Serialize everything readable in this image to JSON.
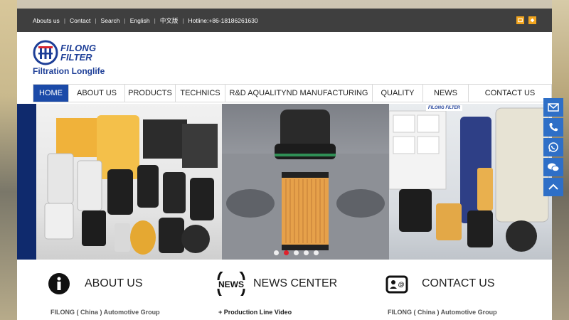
{
  "topbar": {
    "links": [
      "Abouts  us",
      "Contact",
      "Search",
      "English",
      "中文版",
      "Hotline:+86-18186261630"
    ]
  },
  "logo": {
    "name_line1": "FILONG",
    "name_line2": "FILTER",
    "tagline": "Filtration Longlife",
    "brand_color": "#1d3e97"
  },
  "nav": {
    "items": [
      {
        "label": "HOME",
        "active": true
      },
      {
        "label": "ABOUT US"
      },
      {
        "label": "PRODUCTS"
      },
      {
        "label": "TECHNICS"
      },
      {
        "label": "R&D AQUALITYND MANUFACTURING"
      },
      {
        "label": "QUALITY"
      },
      {
        "label": "NEWS"
      },
      {
        "label": "CONTACT US"
      }
    ],
    "active_color": "#1b4aa8"
  },
  "banner": {
    "slides": 5,
    "active_slide": 2,
    "panel_c_label": "FILONG FILTER"
  },
  "features": {
    "about": {
      "title": "ABOUT US",
      "sub": "FILONG ( China ) Automotive Group"
    },
    "news": {
      "title": "NEWS CENTER",
      "icon_text": "NEWS",
      "sub": "+ Production  Line  Video"
    },
    "contact": {
      "title": "CONTACT US",
      "sub": "FILONG ( China ) Automotive Group"
    }
  },
  "side_float": {
    "buttons": [
      "mail-icon",
      "phone-icon",
      "whatsapp-icon",
      "wechat-icon",
      "back-to-top-icon"
    ],
    "color": "#2e6fc7"
  }
}
